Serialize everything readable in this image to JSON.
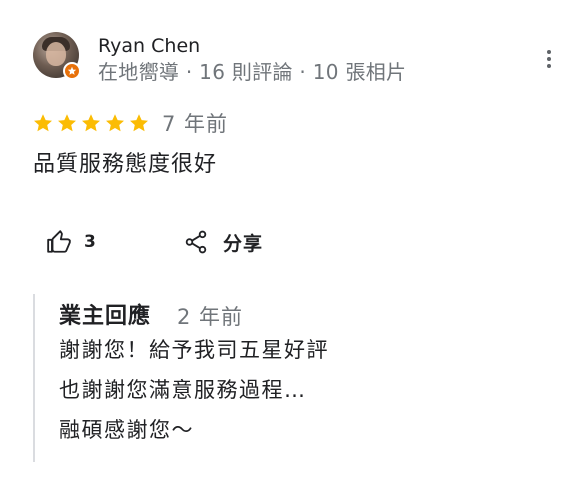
{
  "reviewer": {
    "name": "Ryan Chen",
    "meta": "在地嚮導 · 16 則評論 · 10 張相片",
    "avatar_icon": "profile-photo",
    "badge_icon": "local-guide-badge-icon"
  },
  "review": {
    "rating": 5,
    "max_rating": 5,
    "star_color": "#fbbc04",
    "time": "7 年前",
    "text": "品質服務態度很好"
  },
  "actions": {
    "like_icon": "thumbs-up-icon",
    "like_count": "3",
    "share_icon": "share-icon",
    "share_label": "分享",
    "more_icon": "more-vert-icon"
  },
  "owner_response": {
    "title": "業主回應",
    "time": "2 年前",
    "lines": [
      "謝謝您！給予我司五星好評",
      "也謝謝您滿意服務過程…",
      "融碩感謝您～"
    ]
  },
  "colors": {
    "text_primary": "#202124",
    "text_secondary": "#70757a",
    "badge": "#e8710a",
    "divider": "#dadce0"
  }
}
